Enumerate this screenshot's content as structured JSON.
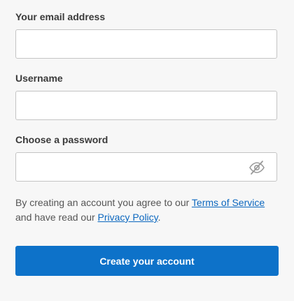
{
  "form": {
    "email": {
      "label": "Your email address",
      "value": "",
      "placeholder": ""
    },
    "username": {
      "label": "Username",
      "value": "",
      "placeholder": ""
    },
    "password": {
      "label": "Choose a password",
      "value": "",
      "placeholder": "",
      "toggle_icon": "eye-slash-icon"
    },
    "legal": {
      "prefix": "By creating an account you agree to our ",
      "terms_link": "Terms of Service",
      "middle": "and have read our ",
      "privacy_link": "Privacy Policy",
      "suffix": "."
    },
    "submit_label": "Create your account"
  },
  "colors": {
    "accent": "#0d72c9",
    "link": "#0b67bf",
    "background": "#f7f7f7",
    "field_border": "#c4c4c4"
  }
}
